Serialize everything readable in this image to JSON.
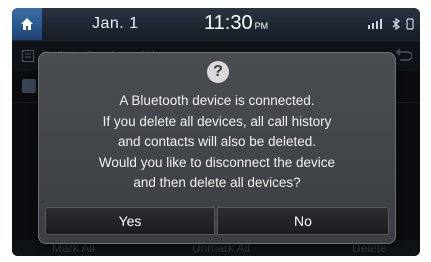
{
  "status_bar": {
    "date": "Jan.  1",
    "time": "11:30",
    "ampm": "PM"
  },
  "header": {
    "title": "Delete Devices (1)"
  },
  "bottom_bar": {
    "left": "Mark All",
    "center": "Unmark All",
    "right": "Delete"
  },
  "dialog": {
    "icon": "?",
    "lines": [
      "A Bluetooth device is connected.",
      "If you delete all devices, all call history",
      "and contacts will also be deleted.",
      "Would you like to disconnect the device",
      "and then delete all devices?"
    ],
    "yes_label": "Yes",
    "no_label": "No"
  },
  "colors": {
    "accent": "#2d5d97",
    "dialog_bg": "#44474c"
  }
}
